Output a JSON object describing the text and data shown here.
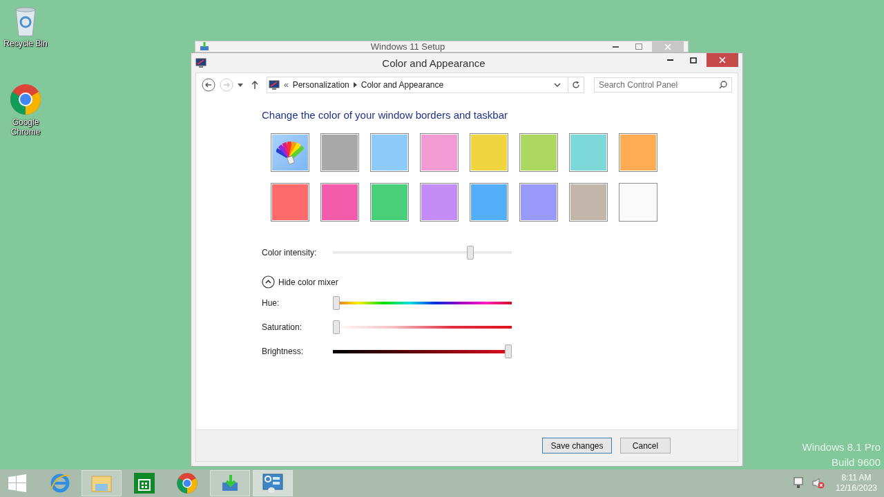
{
  "desktop_icons": [
    {
      "kind": "recycle",
      "label": "Recycle Bin"
    },
    {
      "kind": "chrome",
      "label": "Google Chrome"
    }
  ],
  "background_window": {
    "title": "Windows 11 Setup"
  },
  "window": {
    "title": "Color and Appearance"
  },
  "address_bar": {
    "overflow": "«",
    "crumbs": [
      "Personalization",
      "Color and Appearance"
    ]
  },
  "search": {
    "placeholder": "Search Control Panel"
  },
  "heading": "Change the color of your window borders and taskbar",
  "swatches": [
    {
      "kind": "automatic"
    },
    {
      "kind": "color",
      "color": "#a8a8a8"
    },
    {
      "kind": "color",
      "color": "#8ecbfb"
    },
    {
      "kind": "color",
      "color": "#f29ad4"
    },
    {
      "kind": "color",
      "color": "#f0d540"
    },
    {
      "kind": "color",
      "color": "#acd862"
    },
    {
      "kind": "color",
      "color": "#7dd9d9"
    },
    {
      "kind": "color",
      "color": "#ffac55"
    },
    {
      "kind": "color",
      "color": "#ff6b6b"
    },
    {
      "kind": "color",
      "color": "#f45bab"
    },
    {
      "kind": "color",
      "color": "#48cf77"
    },
    {
      "kind": "color",
      "color": "#c48cf6"
    },
    {
      "kind": "color",
      "color": "#55aef9"
    },
    {
      "kind": "color",
      "color": "#9899f8"
    },
    {
      "kind": "color",
      "color": "#c2b5a9"
    },
    {
      "kind": "color",
      "color": "#fafafa"
    }
  ],
  "intensity": {
    "label": "Color intensity:",
    "level": 0.78
  },
  "mixer_toggle": {
    "label": "Hide color mixer",
    "expanded": true
  },
  "mixer": [
    {
      "kind": "hue",
      "label": "Hue:",
      "level": 0
    },
    {
      "kind": "saturation",
      "label": "Saturation:",
      "level": 0
    },
    {
      "kind": "brightness",
      "label": "Brightness:",
      "level": 1
    }
  ],
  "buttons": [
    {
      "label": "Save changes",
      "default": true
    },
    {
      "label": "Cancel",
      "default": false
    }
  ],
  "edition": [
    "Windows 8.1 Pro",
    "Build 9600"
  ],
  "taskbar": {
    "apps": [
      {
        "kind": "ie",
        "running": false,
        "selected": false
      },
      {
        "kind": "explorer",
        "running": true,
        "selected": false
      },
      {
        "kind": "store",
        "running": false,
        "selected": false
      },
      {
        "kind": "chrome",
        "running": false,
        "selected": false
      },
      {
        "kind": "setup",
        "running": true,
        "selected": false
      },
      {
        "kind": "control",
        "running": true,
        "selected": true
      }
    ],
    "time": "8:11 AM",
    "date": "12/16/2023"
  }
}
